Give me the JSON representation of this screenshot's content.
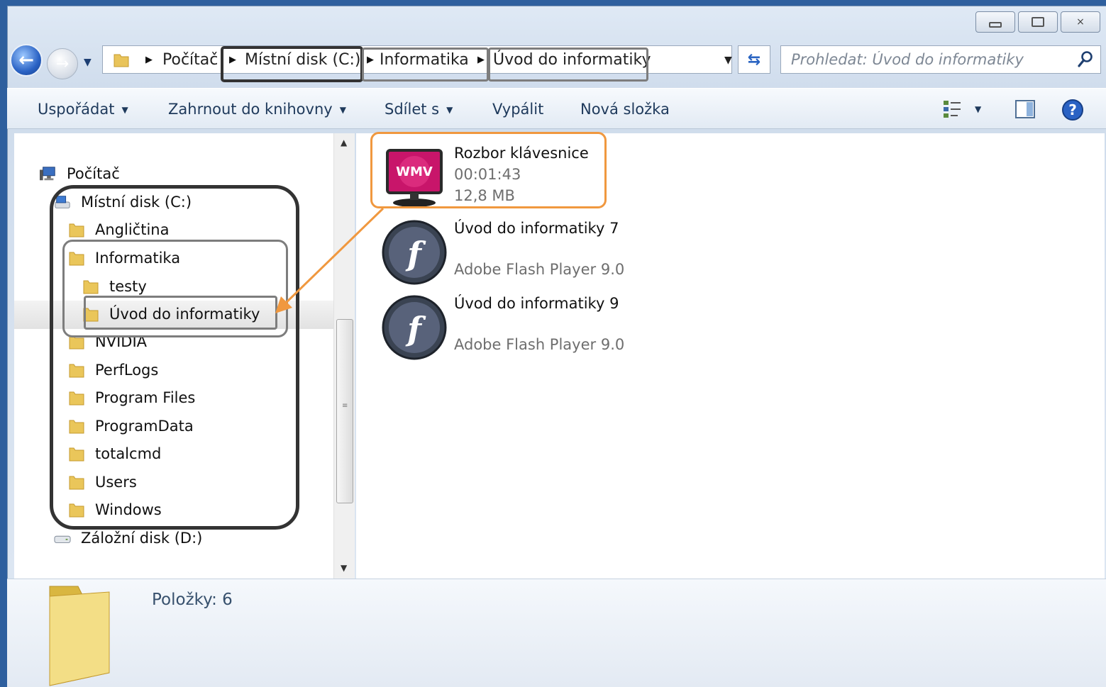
{
  "window": {
    "buttons": {
      "minimize": "minimize",
      "maximize": "maximize",
      "close": "×"
    }
  },
  "navigation": {
    "back_icon": "arrow-left",
    "forward_icon": "arrow-right",
    "breadcrumbs": [
      "Počítač",
      "Místní disk (C:)",
      "Informatika",
      "Úvod do informatiky"
    ],
    "search_placeholder": "Prohledat: Úvod do informatiky"
  },
  "toolbar": {
    "organize": "Uspořádat",
    "include_library": "Zahrnout do knihovny",
    "share": "Sdílet s",
    "burn": "Vypálit",
    "new_folder": "Nová složka"
  },
  "tree": {
    "computer": "Počítač",
    "drive_c": "Místní disk (C:)",
    "folders": [
      "Angličtina",
      "Informatika",
      "testy",
      "Úvod do informatiky",
      "NVIDIA",
      "PerfLogs",
      "Program Files",
      "ProgramData",
      "totalcmd",
      "Users",
      "Windows"
    ],
    "drive_d": "Záložní disk (D:)"
  },
  "files": [
    {
      "name": "Rozbor klávesnice",
      "line2": "00:01:43",
      "line3": "12,8 MB",
      "icon": "wmv-icon",
      "badge": "WMV"
    },
    {
      "name": "Úvod do informatiky 7",
      "line2": "",
      "line3": "Adobe Flash Player 9.0",
      "icon": "flash-icon",
      "badge": "f"
    },
    {
      "name": "Úvod do informatiky 9",
      "line2": "",
      "line3": "Adobe Flash Player 9.0",
      "icon": "flash-icon",
      "badge": "f"
    }
  ],
  "status": {
    "items": "Položky: 6"
  },
  "colors": {
    "highlight_orange": "#f0983f",
    "highlight_dark": "#333333",
    "accent_blue": "#2a62c4"
  }
}
